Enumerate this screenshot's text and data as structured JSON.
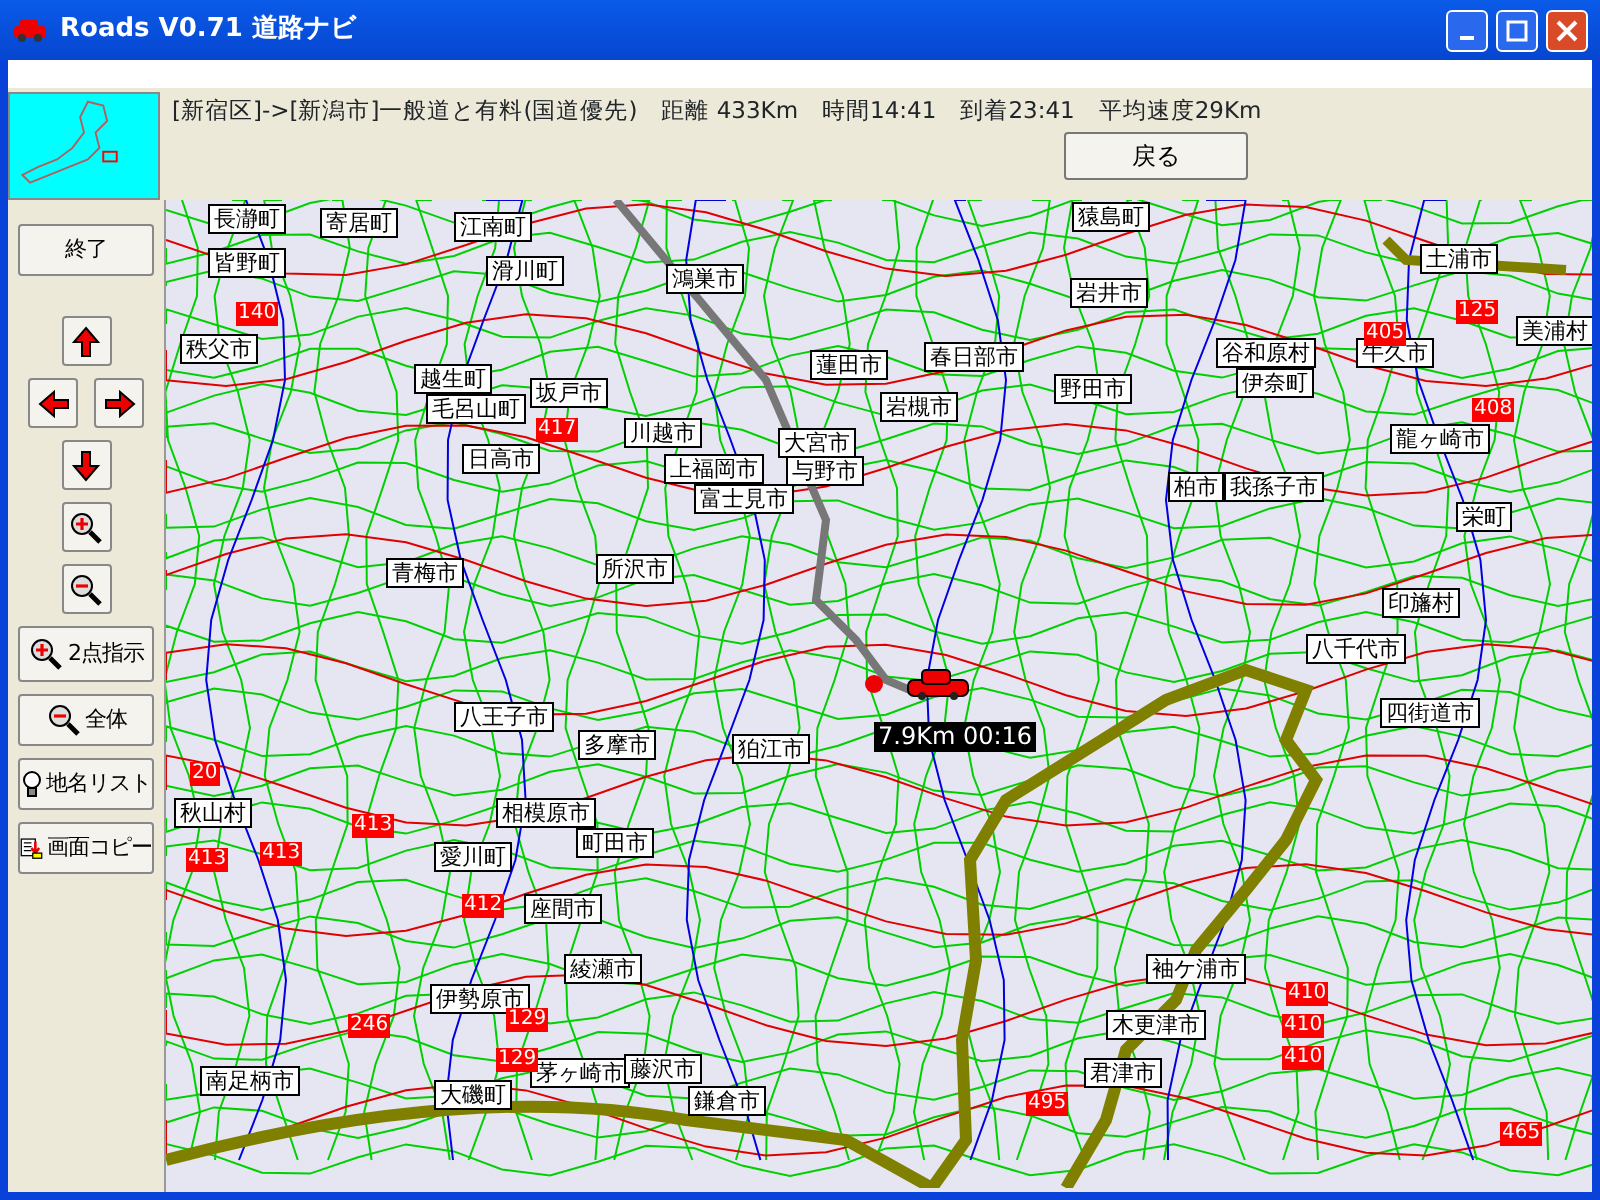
{
  "window": {
    "title": "Roads V0.71 道路ナビ"
  },
  "route_info": {
    "text": "[新宿区]->[新潟市]一般道と有料(国道優先)　距離 433Km　時間14:41　到着23:41　平均速度29Km",
    "back_button": "戻る"
  },
  "sidebar": {
    "buttons": [
      {
        "kind": "text",
        "label": "終了"
      },
      {
        "kind": "arrow_up"
      },
      {
        "kind": "arrow_left"
      },
      {
        "kind": "arrow_right"
      },
      {
        "kind": "arrow_down"
      },
      {
        "kind": "zoom_in"
      },
      {
        "kind": "zoom_out"
      },
      {
        "kind": "zoom_in_text",
        "label": "2点指示"
      },
      {
        "kind": "zoom_out_text",
        "label": "全体"
      },
      {
        "kind": "bulb_text",
        "label": "地名リスト"
      },
      {
        "kind": "copy_text",
        "label": "画面コピー"
      }
    ]
  },
  "map": {
    "place_labels": [
      "長瀞町",
      "寄居町",
      "江南町",
      "皆野町",
      "滑川町",
      "鴻巣市",
      "秩父市",
      "越生町",
      "毛呂山町",
      "坂戸市",
      "川越市",
      "日高市",
      "上福岡市",
      "大宮市",
      "与野市",
      "富士見市",
      "所沢市",
      "青梅市",
      "蓮田市",
      "猿島町",
      "岩井市",
      "土浦市",
      "春日部市",
      "野田市",
      "谷和原村",
      "伊奈町",
      "牛久市",
      "美浦村",
      "龍ヶ崎市",
      "柏市",
      "我孫子市",
      "栄町",
      "印旛村",
      "八千代市",
      "岩槻市",
      "八王子市",
      "多摩市",
      "狛江市",
      "秋山村",
      "相模原市",
      "町田市",
      "愛川町",
      "座間市",
      "綾瀬市",
      "伊勢原市",
      "茅ヶ崎市",
      "藤沢市",
      "南足柄市",
      "鎌倉市",
      "大磯町",
      "四街道市",
      "袖ケ浦市",
      "木更津市",
      "君津市"
    ],
    "route_numbers": [
      "140",
      "417",
      "20",
      "413",
      "413",
      "413",
      "412",
      "246",
      "129",
      "129",
      "410",
      "410",
      "410",
      "408",
      "405",
      "125",
      "465",
      "495"
    ],
    "distance_overlay": "7.9Km 00:16"
  }
}
